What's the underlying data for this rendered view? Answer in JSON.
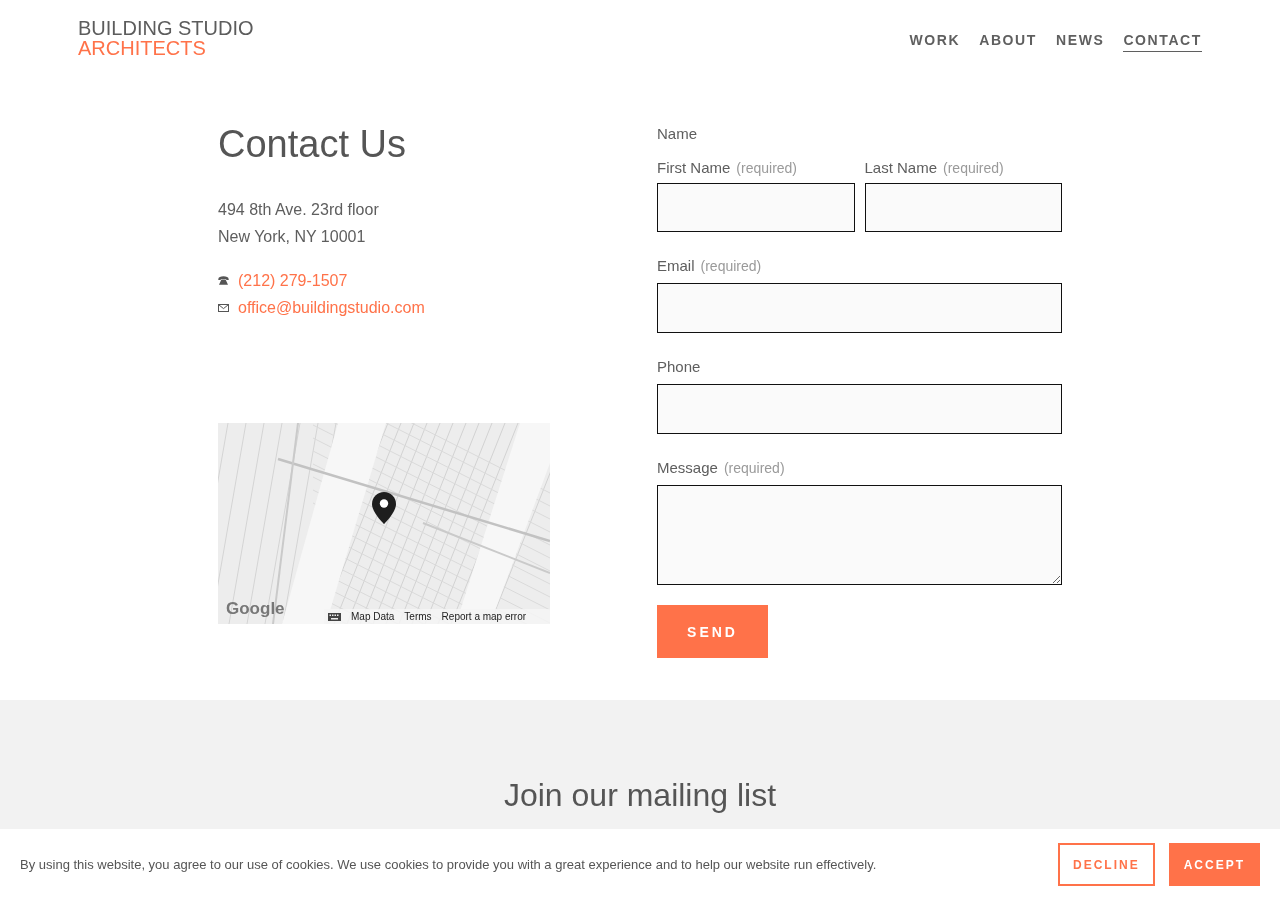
{
  "header": {
    "logo": {
      "line_1": "BUILDING STUDIO",
      "line_2": "ARCHITECTS"
    },
    "nav": [
      {
        "label": "WORK",
        "selected": false
      },
      {
        "label": "ABOUT",
        "selected": false
      },
      {
        "label": "NEWS",
        "selected": false
      },
      {
        "label": "CONTACT",
        "selected": true
      }
    ]
  },
  "contact": {
    "title": "Contact Us",
    "address": [
      "494 8th Ave. 23rd floor",
      "New York, NY 10001"
    ],
    "links": [
      {
        "kind": "phone",
        "text": "(212) 279-1507"
      },
      {
        "kind": "email",
        "text": "office@buildingstudio.com"
      }
    ],
    "map": {
      "logo": "Google",
      "attribution": [
        "Map Data",
        "Terms",
        "Report a map error"
      ]
    }
  },
  "form": {
    "name_group": {
      "label": "Name",
      "fields": [
        {
          "label": "First Name",
          "note": "(required)"
        },
        {
          "label": "Last Name",
          "note": "(required)"
        }
      ]
    },
    "fields": [
      {
        "kind": "input",
        "label": "Email",
        "note": "(required)"
      },
      {
        "kind": "input",
        "label": "Phone"
      },
      {
        "kind": "textarea",
        "label": "Message",
        "note": "(required)"
      }
    ],
    "submit": "SEND"
  },
  "mailing_list": {
    "title": "Join our mailing list"
  },
  "cookie_banner": {
    "text": "By using this website, you agree to our use of cookies. We use cookies to provide you with a great experience and to help our website run effectively.",
    "buttons": [
      {
        "kind": "outline",
        "label": "DECLINE"
      },
      {
        "kind": "filled",
        "label": "ACCEPT"
      }
    ]
  }
}
